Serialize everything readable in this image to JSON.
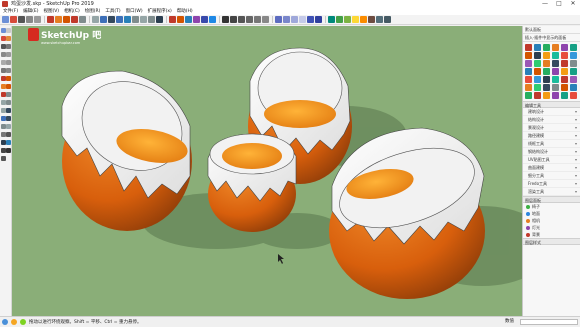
{
  "window": {
    "title": "鸡蛋沙发.skp - SketchUp Pro 2019",
    "minimize": "—",
    "maximize": "□",
    "close": "✕"
  },
  "menu": [
    "文件(F)",
    "编辑(E)",
    "视图(V)",
    "相机(C)",
    "绘图(R)",
    "工具(T)",
    "窗口(W)",
    "扩展程序(x)",
    "帮助(H)"
  ],
  "logo": {
    "name": "SketchUp 吧",
    "url_text": "www.sketchupbar.com"
  },
  "tray": {
    "header": "默认面板",
    "sub_header": "插入·插件中显示的面板",
    "section_tools": "编辑工具",
    "plugins": [
      "建筑设计",
      "结构设计",
      "景观设计",
      "路径建模",
      "线框工具",
      "钢结构设计",
      "UV贴图工具",
      "曲面建模",
      "细分工具",
      "Fredo工具",
      "渲染工具"
    ],
    "section_layers": "图层面板",
    "layers": [
      {
        "label": "椅子",
        "color": "#3cb043"
      },
      {
        "label": "地面",
        "color": "#2e86de"
      },
      {
        "label": "相机",
        "color": "#e67e22"
      },
      {
        "label": "灯光",
        "color": "#8e44ad"
      },
      {
        "label": "背景",
        "color": "#c0392b"
      }
    ],
    "footer": "图层样式"
  },
  "status": {
    "hint": "拖动以进行环绕观察。Shift = 平移、Ctrl = 重力悬停。",
    "measure_label": "数值",
    "measure_value": ""
  },
  "colors": {
    "viewport": "#8aae78",
    "shell_orange": "#e06a10",
    "shell_white": "#ffffff",
    "cushion": "#f59a1f",
    "accent_red": "#d62a20"
  }
}
